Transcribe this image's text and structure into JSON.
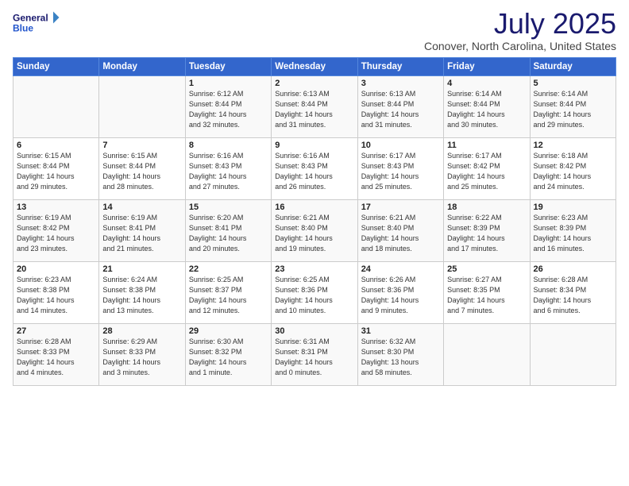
{
  "logo": {
    "line1": "General",
    "line2": "Blue"
  },
  "title": "July 2025",
  "subtitle": "Conover, North Carolina, United States",
  "days_header": [
    "Sunday",
    "Monday",
    "Tuesday",
    "Wednesday",
    "Thursday",
    "Friday",
    "Saturday"
  ],
  "weeks": [
    [
      {
        "day": "",
        "detail": ""
      },
      {
        "day": "",
        "detail": ""
      },
      {
        "day": "1",
        "detail": "Sunrise: 6:12 AM\nSunset: 8:44 PM\nDaylight: 14 hours\nand 32 minutes."
      },
      {
        "day": "2",
        "detail": "Sunrise: 6:13 AM\nSunset: 8:44 PM\nDaylight: 14 hours\nand 31 minutes."
      },
      {
        "day": "3",
        "detail": "Sunrise: 6:13 AM\nSunset: 8:44 PM\nDaylight: 14 hours\nand 31 minutes."
      },
      {
        "day": "4",
        "detail": "Sunrise: 6:14 AM\nSunset: 8:44 PM\nDaylight: 14 hours\nand 30 minutes."
      },
      {
        "day": "5",
        "detail": "Sunrise: 6:14 AM\nSunset: 8:44 PM\nDaylight: 14 hours\nand 29 minutes."
      }
    ],
    [
      {
        "day": "6",
        "detail": "Sunrise: 6:15 AM\nSunset: 8:44 PM\nDaylight: 14 hours\nand 29 minutes."
      },
      {
        "day": "7",
        "detail": "Sunrise: 6:15 AM\nSunset: 8:44 PM\nDaylight: 14 hours\nand 28 minutes."
      },
      {
        "day": "8",
        "detail": "Sunrise: 6:16 AM\nSunset: 8:43 PM\nDaylight: 14 hours\nand 27 minutes."
      },
      {
        "day": "9",
        "detail": "Sunrise: 6:16 AM\nSunset: 8:43 PM\nDaylight: 14 hours\nand 26 minutes."
      },
      {
        "day": "10",
        "detail": "Sunrise: 6:17 AM\nSunset: 8:43 PM\nDaylight: 14 hours\nand 25 minutes."
      },
      {
        "day": "11",
        "detail": "Sunrise: 6:17 AM\nSunset: 8:42 PM\nDaylight: 14 hours\nand 25 minutes."
      },
      {
        "day": "12",
        "detail": "Sunrise: 6:18 AM\nSunset: 8:42 PM\nDaylight: 14 hours\nand 24 minutes."
      }
    ],
    [
      {
        "day": "13",
        "detail": "Sunrise: 6:19 AM\nSunset: 8:42 PM\nDaylight: 14 hours\nand 23 minutes."
      },
      {
        "day": "14",
        "detail": "Sunrise: 6:19 AM\nSunset: 8:41 PM\nDaylight: 14 hours\nand 21 minutes."
      },
      {
        "day": "15",
        "detail": "Sunrise: 6:20 AM\nSunset: 8:41 PM\nDaylight: 14 hours\nand 20 minutes."
      },
      {
        "day": "16",
        "detail": "Sunrise: 6:21 AM\nSunset: 8:40 PM\nDaylight: 14 hours\nand 19 minutes."
      },
      {
        "day": "17",
        "detail": "Sunrise: 6:21 AM\nSunset: 8:40 PM\nDaylight: 14 hours\nand 18 minutes."
      },
      {
        "day": "18",
        "detail": "Sunrise: 6:22 AM\nSunset: 8:39 PM\nDaylight: 14 hours\nand 17 minutes."
      },
      {
        "day": "19",
        "detail": "Sunrise: 6:23 AM\nSunset: 8:39 PM\nDaylight: 14 hours\nand 16 minutes."
      }
    ],
    [
      {
        "day": "20",
        "detail": "Sunrise: 6:23 AM\nSunset: 8:38 PM\nDaylight: 14 hours\nand 14 minutes."
      },
      {
        "day": "21",
        "detail": "Sunrise: 6:24 AM\nSunset: 8:38 PM\nDaylight: 14 hours\nand 13 minutes."
      },
      {
        "day": "22",
        "detail": "Sunrise: 6:25 AM\nSunset: 8:37 PM\nDaylight: 14 hours\nand 12 minutes."
      },
      {
        "day": "23",
        "detail": "Sunrise: 6:25 AM\nSunset: 8:36 PM\nDaylight: 14 hours\nand 10 minutes."
      },
      {
        "day": "24",
        "detail": "Sunrise: 6:26 AM\nSunset: 8:36 PM\nDaylight: 14 hours\nand 9 minutes."
      },
      {
        "day": "25",
        "detail": "Sunrise: 6:27 AM\nSunset: 8:35 PM\nDaylight: 14 hours\nand 7 minutes."
      },
      {
        "day": "26",
        "detail": "Sunrise: 6:28 AM\nSunset: 8:34 PM\nDaylight: 14 hours\nand 6 minutes."
      }
    ],
    [
      {
        "day": "27",
        "detail": "Sunrise: 6:28 AM\nSunset: 8:33 PM\nDaylight: 14 hours\nand 4 minutes."
      },
      {
        "day": "28",
        "detail": "Sunrise: 6:29 AM\nSunset: 8:33 PM\nDaylight: 14 hours\nand 3 minutes."
      },
      {
        "day": "29",
        "detail": "Sunrise: 6:30 AM\nSunset: 8:32 PM\nDaylight: 14 hours\nand 1 minute."
      },
      {
        "day": "30",
        "detail": "Sunrise: 6:31 AM\nSunset: 8:31 PM\nDaylight: 14 hours\nand 0 minutes."
      },
      {
        "day": "31",
        "detail": "Sunrise: 6:32 AM\nSunset: 8:30 PM\nDaylight: 13 hours\nand 58 minutes."
      },
      {
        "day": "",
        "detail": ""
      },
      {
        "day": "",
        "detail": ""
      }
    ]
  ]
}
